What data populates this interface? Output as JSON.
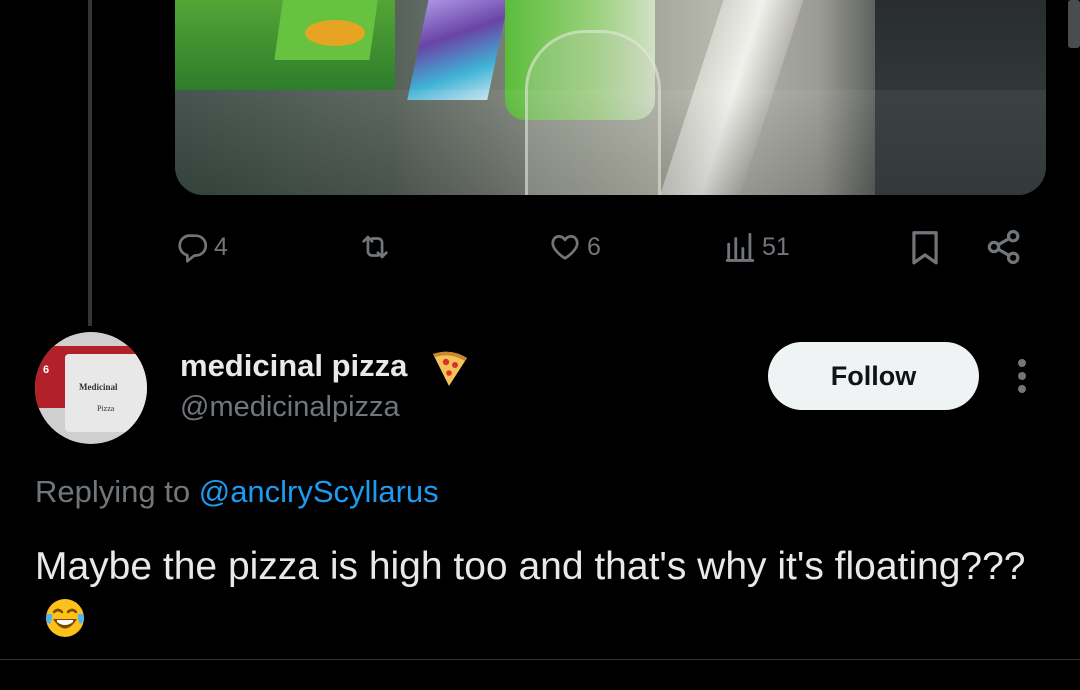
{
  "post": {
    "actions": {
      "replies": "4",
      "likes": "6",
      "views": "51"
    }
  },
  "reply": {
    "display_name": "medicinal pizza",
    "handle": "@medicinalpizza",
    "follow_label": "Follow",
    "replying_prefix": "Replying to",
    "replying_mention": "@anclryScyllarus",
    "text": "Maybe the pizza is high too and that's why it's floating???",
    "avatar_text": {
      "number": "6",
      "line1": "Medicinal",
      "line2": "Pizza"
    }
  },
  "icons": {
    "reply": "reply-icon",
    "repost": "repost-icon",
    "like": "heart-icon",
    "views": "views-icon",
    "bookmark": "bookmark-icon",
    "share": "share-icon",
    "more": "more-options-icon",
    "badge": "pizza-emoji-icon",
    "emoji": "tears-of-joy-emoji-icon"
  },
  "colors": {
    "background": "#000000",
    "text": "#e7e9ea",
    "secondary": "#71767b",
    "link": "#1d9bf0",
    "follow_button": "#eff3f4"
  }
}
